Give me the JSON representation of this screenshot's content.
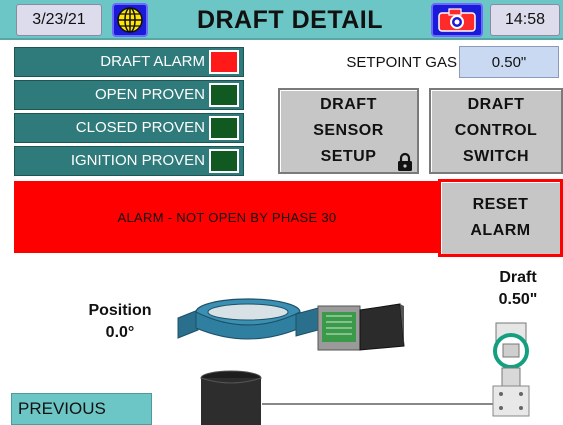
{
  "header": {
    "date": "3/23/21",
    "title": "DRAFT DETAIL",
    "time": "14:58",
    "icons": {
      "language": "globe-icon",
      "screenshot": "camera-icon"
    }
  },
  "status": [
    {
      "label": "DRAFT ALARM",
      "state": "red"
    },
    {
      "label": "OPEN PROVEN",
      "state": "green"
    },
    {
      "label": "CLOSED PROVEN",
      "state": "green"
    },
    {
      "label": "IGNITION PROVEN",
      "state": "green"
    }
  ],
  "setpoint": {
    "label": "SETPOINT GAS",
    "value": "0.50\""
  },
  "buttons": {
    "draft_sensor_setup": "DRAFT\nSENSOR\nSETUP",
    "draft_control_switch": "DRAFT\nCONTROL\nSWITCH",
    "reset_alarm": "RESET\nALARM",
    "previous": "PREVIOUS"
  },
  "alarm": {
    "message": "ALARM - NOT OPEN BY PHASE 30"
  },
  "position": {
    "label": "Position",
    "value": "0.0°"
  },
  "draft": {
    "label": "Draft",
    "value": "0.50\""
  },
  "colors": {
    "header": "#6cc6c6",
    "status_panel": "#2f7a7a",
    "alarm": "#ff0000",
    "led_green": "#105a22",
    "led_red": "#ff1a1a",
    "setpoint_box": "#c9d9f2",
    "button_gray": "#c6c6c6",
    "damper_blue": "#2e7fa0"
  }
}
